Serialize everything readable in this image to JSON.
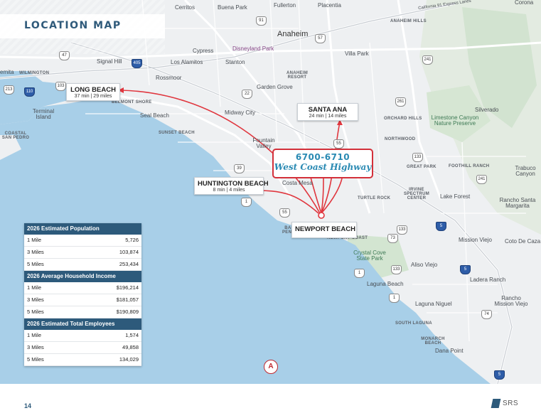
{
  "page_title": "LOCATION MAP",
  "page_number": "14",
  "logo_text": "SRS",
  "compass_label": "A",
  "subject": {
    "address": "6700-6710",
    "street": "West Coast Highway"
  },
  "callouts": [
    {
      "id": "long-beach",
      "name": "LONG BEACH",
      "drive": "37 min | 29 miles"
    },
    {
      "id": "santa-ana",
      "name": "SANTA ANA",
      "drive": "24 min | 14 miles"
    },
    {
      "id": "huntington-beach",
      "name": "HUNTINGTON BEACH",
      "drive": "8 min | 4 miles"
    },
    {
      "id": "newport-beach",
      "name": "NEWPORT BEACH",
      "drive": ""
    }
  ],
  "place_labels": {
    "cerritos": "Cerritos",
    "buena_park": "Buena Park",
    "fullerton": "Fullerton",
    "placentia": "Placentia",
    "corona": "Corona",
    "anaheim_hills": "ANAHEIM HILLS",
    "california_91_express_lanes": "California 91 Express Lanes",
    "anaheim": "Anaheim",
    "cypress": "Cypress",
    "disneyland_park": "Disneyland Park",
    "villa_park": "Villa Park",
    "wilmington": "WILMINGTON",
    "signal_hill": "Signal Hill",
    "los_alamitos": "Los Alamitos",
    "stanton": "Stanton",
    "anaheim_resort": "ANAHEIM RESORT",
    "rossmoor": "Rossmoor",
    "garden_grove": "Garden Grove",
    "belmont_shore": "BELMONT SHORE",
    "midway_city": "Midway City",
    "seal_beach": "Seal Beach",
    "terminal_island": "Terminal Island",
    "coastal_san_pedro": "COASTAL SAN PEDRO",
    "sunset_beach": "SUNSET BEACH",
    "silverado": "Silverado",
    "orchard_hills": "ORCHARD HILLS",
    "limestone_canyon": "Limestone Canyon Nature Preserve",
    "northwood": "NORTHWOOD",
    "fountain_valley": "Fountain Valley",
    "great_park": "GREAT PARK",
    "foothill_ranch": "FOOTHILL RANCH",
    "trabuco_canyon": "Trabuco Canyon",
    "costa_mesa": "Costa Mesa",
    "irvine_spectrum": "IRVINE SPECTRUM CENTER",
    "turtle_rock": "TURTLE ROCK",
    "lake_forest": "Lake Forest",
    "rancho_santa_margarita": "Rancho Santa Margarita",
    "balboa_peninsula": "BALBOA PENINSULA",
    "newport_coast": "NEWPORT COAST",
    "mission_viejo": "Mission Viejo",
    "coto_de_caza": "Coto De Caza",
    "crystal_cove": "Crystal Cove State Park",
    "aliso_viejo": "Aliso Viejo",
    "ladera_ranch": "Ladera Ranch",
    "laguna_beach": "Laguna Beach",
    "rancho_mission_viejo": "Rancho Mission Viejo",
    "laguna_niguel": "Laguna Niguel",
    "south_laguna": "SOUTH LAGUNA",
    "monarch_beach": "MONARCH BEACH",
    "dana_point": "Dana Point",
    "emita": "emita"
  },
  "highway_shields": {
    "r91": "91",
    "r57": "57",
    "r47": "47",
    "r405a": "405",
    "r103": "103",
    "r110": "110",
    "r213": "213",
    "r22": "22",
    "r39": "39",
    "r55a": "55",
    "r55b": "55",
    "r1a": "1",
    "r1b": "1",
    "r1c": "1",
    "r133a": "133",
    "r133b": "133",
    "r133c": "133",
    "r73": "73",
    "r241a": "241",
    "r241b": "241",
    "r261": "261",
    "r5a": "5",
    "r5b": "5",
    "r5c": "5",
    "r74": "74"
  },
  "stats": [
    {
      "header": "2026 Estimated Population",
      "rows": [
        {
          "label": "1 Mile",
          "value": "5,726"
        },
        {
          "label": "3 Miles",
          "value": "103,874"
        },
        {
          "label": "5 Miles",
          "value": "253,434"
        }
      ]
    },
    {
      "header": "2026 Average Household Income",
      "rows": [
        {
          "label": "1 Mile",
          "value": "$196,214"
        },
        {
          "label": "3 Miles",
          "value": "$181,057"
        },
        {
          "label": "5 Miles",
          "value": "$190,809"
        }
      ]
    },
    {
      "header": "2026 Estimated Total Employees",
      "rows": [
        {
          "label": "1 Mile",
          "value": "1,574"
        },
        {
          "label": "3 Miles",
          "value": "49,858"
        },
        {
          "label": "5 Miles",
          "value": "134,029"
        }
      ]
    }
  ],
  "colors": {
    "ocean": "#a8cfe8",
    "land": "#eef0f2",
    "park": "#cfe3cf",
    "arrow": "#e0363e",
    "banner_text": "#2f5a7a",
    "table_header": "#2d5a7b",
    "subject_text": "#2a8ab3"
  }
}
